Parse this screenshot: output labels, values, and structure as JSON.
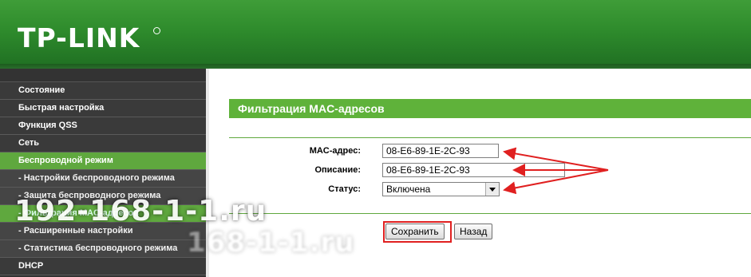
{
  "brand": {
    "logo_text": "TP-LINK"
  },
  "sidebar": {
    "items": [
      {
        "label": "Состояние"
      },
      {
        "label": "Быстрая настройка"
      },
      {
        "label": "Функция QSS"
      },
      {
        "label": "Сеть"
      },
      {
        "label": "Беспроводной режим"
      },
      {
        "label": "- Настройки беспроводного режима"
      },
      {
        "label": "- Защита беспроводного режима"
      },
      {
        "label": "- Фильтрация MAC-адресов"
      },
      {
        "label": "- Расширенные настройки"
      },
      {
        "label": "- Статистика беспроводного режима"
      },
      {
        "label": "DHCP"
      }
    ],
    "active_index": 4,
    "active_sub_index": 7
  },
  "page": {
    "title": "Фильтрация MAC-адресов",
    "fields": {
      "mac": {
        "label": "MAC-адрес:",
        "value": "08-E6-89-1E-2C-93"
      },
      "description": {
        "label": "Описание:",
        "value": "08-E6-89-1E-2C-93"
      },
      "status": {
        "label": "Статус:",
        "value": "Включена"
      }
    },
    "buttons": {
      "save": "Сохранить",
      "back": "Назад"
    }
  },
  "watermark": {
    "text": "192-168-1-1.ru",
    "text_faint": "168-1-1.ru"
  },
  "colors": {
    "brand_green": "#2e8b2c",
    "accent_green": "#5fb23a",
    "sidebar_bg": "#333333",
    "annotation_red": "#e02020"
  }
}
